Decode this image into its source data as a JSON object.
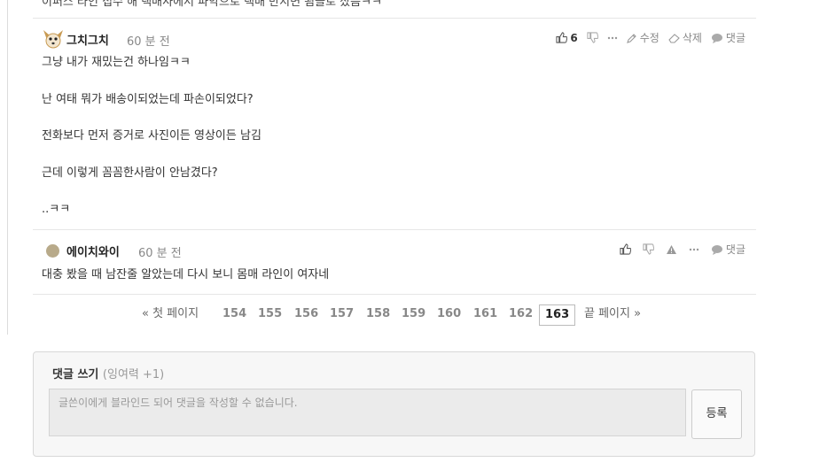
{
  "top_cut_text": "이퍼스 라인 접수 해 택배사에서 파악으로 택배 만지면 됨을로 잤음ㅋㅋ",
  "comments": [
    {
      "author": "그치그치",
      "time": "60 분 전",
      "likes": "6",
      "actions": {
        "edit": "수정",
        "delete": "삭제",
        "reply": "댓글"
      },
      "lines": [
        "그냥 내가 재밌는건 하나임ㅋㅋ",
        "",
        "난 여태 뭐가 배송이되었는데 파손이되었다?",
        "",
        "전화보다 먼저 증거로 사진이든 영상이든 남김",
        "",
        "근데 이렇게 꼼꼼한사람이 안남겼다?",
        "",
        "..ㅋㅋ"
      ]
    },
    {
      "author": "에이치와이",
      "time": "60 분 전",
      "actions": {
        "reply": "댓글"
      },
      "lines": [
        "대충 봤을 때 남잔줄 알았는데 다시 보니 몸매 라인이 여자네"
      ]
    }
  ],
  "pagination": {
    "first": "« 첫 페이지",
    "last": "끝 페이지 »",
    "pages": [
      "154",
      "155",
      "156",
      "157",
      "158",
      "159",
      "160",
      "161",
      "162"
    ],
    "current": "163"
  },
  "write": {
    "title": "댓글 쓰기",
    "subtitle": "(잉여력 +1)",
    "placeholder": "글쓴이에게 블라인드 되어 댓글을 작성할 수 없습니다.",
    "submit": "등록"
  }
}
